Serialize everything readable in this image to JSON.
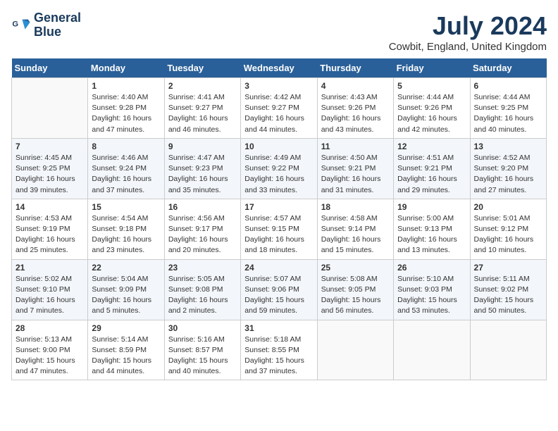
{
  "header": {
    "logo_line1": "General",
    "logo_line2": "Blue",
    "month": "July 2024",
    "location": "Cowbit, England, United Kingdom"
  },
  "days_of_week": [
    "Sunday",
    "Monday",
    "Tuesday",
    "Wednesday",
    "Thursday",
    "Friday",
    "Saturday"
  ],
  "weeks": [
    [
      {
        "day": "",
        "info": ""
      },
      {
        "day": "1",
        "info": "Sunrise: 4:40 AM\nSunset: 9:28 PM\nDaylight: 16 hours\nand 47 minutes."
      },
      {
        "day": "2",
        "info": "Sunrise: 4:41 AM\nSunset: 9:27 PM\nDaylight: 16 hours\nand 46 minutes."
      },
      {
        "day": "3",
        "info": "Sunrise: 4:42 AM\nSunset: 9:27 PM\nDaylight: 16 hours\nand 44 minutes."
      },
      {
        "day": "4",
        "info": "Sunrise: 4:43 AM\nSunset: 9:26 PM\nDaylight: 16 hours\nand 43 minutes."
      },
      {
        "day": "5",
        "info": "Sunrise: 4:44 AM\nSunset: 9:26 PM\nDaylight: 16 hours\nand 42 minutes."
      },
      {
        "day": "6",
        "info": "Sunrise: 4:44 AM\nSunset: 9:25 PM\nDaylight: 16 hours\nand 40 minutes."
      }
    ],
    [
      {
        "day": "7",
        "info": "Sunrise: 4:45 AM\nSunset: 9:25 PM\nDaylight: 16 hours\nand 39 minutes."
      },
      {
        "day": "8",
        "info": "Sunrise: 4:46 AM\nSunset: 9:24 PM\nDaylight: 16 hours\nand 37 minutes."
      },
      {
        "day": "9",
        "info": "Sunrise: 4:47 AM\nSunset: 9:23 PM\nDaylight: 16 hours\nand 35 minutes."
      },
      {
        "day": "10",
        "info": "Sunrise: 4:49 AM\nSunset: 9:22 PM\nDaylight: 16 hours\nand 33 minutes."
      },
      {
        "day": "11",
        "info": "Sunrise: 4:50 AM\nSunset: 9:21 PM\nDaylight: 16 hours\nand 31 minutes."
      },
      {
        "day": "12",
        "info": "Sunrise: 4:51 AM\nSunset: 9:21 PM\nDaylight: 16 hours\nand 29 minutes."
      },
      {
        "day": "13",
        "info": "Sunrise: 4:52 AM\nSunset: 9:20 PM\nDaylight: 16 hours\nand 27 minutes."
      }
    ],
    [
      {
        "day": "14",
        "info": "Sunrise: 4:53 AM\nSunset: 9:19 PM\nDaylight: 16 hours\nand 25 minutes."
      },
      {
        "day": "15",
        "info": "Sunrise: 4:54 AM\nSunset: 9:18 PM\nDaylight: 16 hours\nand 23 minutes."
      },
      {
        "day": "16",
        "info": "Sunrise: 4:56 AM\nSunset: 9:17 PM\nDaylight: 16 hours\nand 20 minutes."
      },
      {
        "day": "17",
        "info": "Sunrise: 4:57 AM\nSunset: 9:15 PM\nDaylight: 16 hours\nand 18 minutes."
      },
      {
        "day": "18",
        "info": "Sunrise: 4:58 AM\nSunset: 9:14 PM\nDaylight: 16 hours\nand 15 minutes."
      },
      {
        "day": "19",
        "info": "Sunrise: 5:00 AM\nSunset: 9:13 PM\nDaylight: 16 hours\nand 13 minutes."
      },
      {
        "day": "20",
        "info": "Sunrise: 5:01 AM\nSunset: 9:12 PM\nDaylight: 16 hours\nand 10 minutes."
      }
    ],
    [
      {
        "day": "21",
        "info": "Sunrise: 5:02 AM\nSunset: 9:10 PM\nDaylight: 16 hours\nand 7 minutes."
      },
      {
        "day": "22",
        "info": "Sunrise: 5:04 AM\nSunset: 9:09 PM\nDaylight: 16 hours\nand 5 minutes."
      },
      {
        "day": "23",
        "info": "Sunrise: 5:05 AM\nSunset: 9:08 PM\nDaylight: 16 hours\nand 2 minutes."
      },
      {
        "day": "24",
        "info": "Sunrise: 5:07 AM\nSunset: 9:06 PM\nDaylight: 15 hours\nand 59 minutes."
      },
      {
        "day": "25",
        "info": "Sunrise: 5:08 AM\nSunset: 9:05 PM\nDaylight: 15 hours\nand 56 minutes."
      },
      {
        "day": "26",
        "info": "Sunrise: 5:10 AM\nSunset: 9:03 PM\nDaylight: 15 hours\nand 53 minutes."
      },
      {
        "day": "27",
        "info": "Sunrise: 5:11 AM\nSunset: 9:02 PM\nDaylight: 15 hours\nand 50 minutes."
      }
    ],
    [
      {
        "day": "28",
        "info": "Sunrise: 5:13 AM\nSunset: 9:00 PM\nDaylight: 15 hours\nand 47 minutes."
      },
      {
        "day": "29",
        "info": "Sunrise: 5:14 AM\nSunset: 8:59 PM\nDaylight: 15 hours\nand 44 minutes."
      },
      {
        "day": "30",
        "info": "Sunrise: 5:16 AM\nSunset: 8:57 PM\nDaylight: 15 hours\nand 40 minutes."
      },
      {
        "day": "31",
        "info": "Sunrise: 5:18 AM\nSunset: 8:55 PM\nDaylight: 15 hours\nand 37 minutes."
      },
      {
        "day": "",
        "info": ""
      },
      {
        "day": "",
        "info": ""
      },
      {
        "day": "",
        "info": ""
      }
    ]
  ]
}
